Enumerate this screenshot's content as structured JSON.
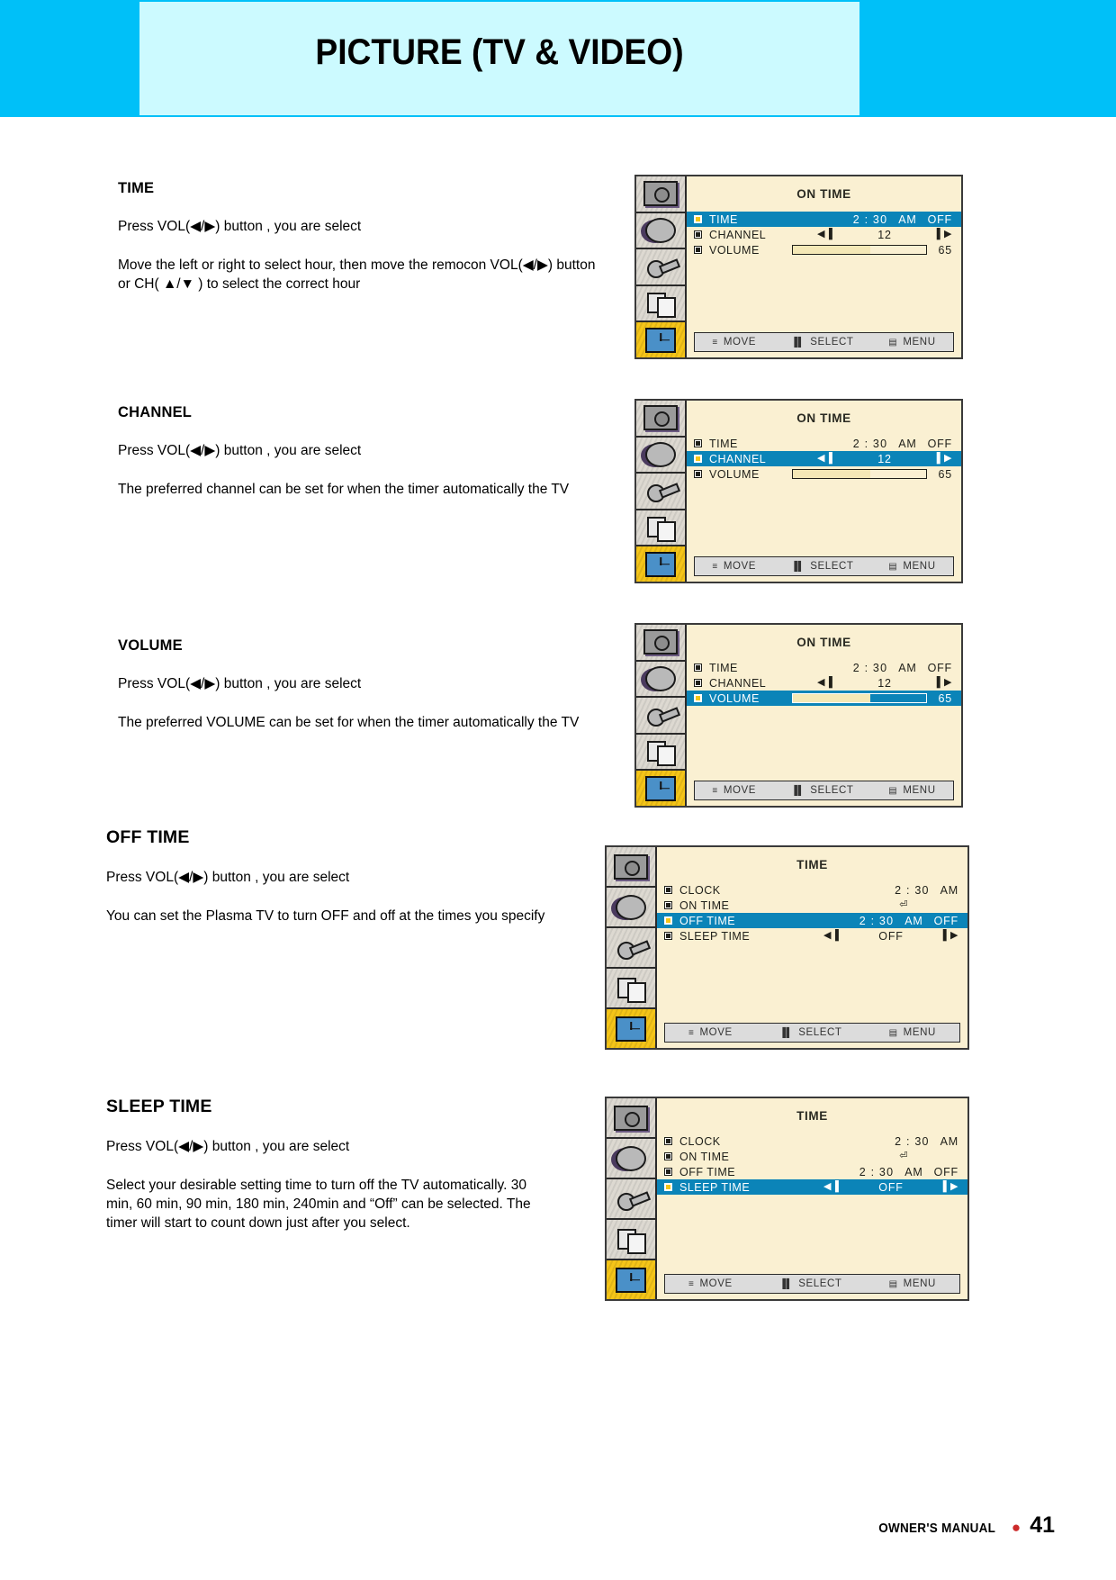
{
  "header": {
    "title": "PICTURE (TV & VIDEO)",
    "band_color": "#00c0f8",
    "panel_color": "#ccfaff"
  },
  "sections": [
    {
      "heading": "TIME",
      "heading_size": "small",
      "paragraphs": [
        "Press  VOL(◀/▶) button , you are select",
        "Move the left or right to select hour, then move the remocon VOL(◀/▶) button or CH( ▲/▼ ) to select the correct hour"
      ]
    },
    {
      "heading": "CHANNEL",
      "heading_size": "small",
      "paragraphs": [
        "Press  VOL(◀/▶) button , you are select",
        "The preferred channel can be set for when the timer automatically the TV"
      ]
    },
    {
      "heading": "VOLUME",
      "heading_size": "small",
      "paragraphs": [
        "Press  VOL(◀/▶) button , you are select",
        "The preferred VOLUME can be set for when the timer automatically the TV"
      ]
    },
    {
      "heading": "OFF TIME",
      "heading_size": "big",
      "paragraphs": [
        "Press  VOL(◀/▶) button , you are select",
        "You can set the Plasma TV to turn OFF and off at the times you specify"
      ]
    },
    {
      "heading": "SLEEP TIME",
      "heading_size": "big",
      "paragraphs": [
        "Press  VOL(◀/▶) button , you are select",
        "Select your desirable setting time to turn off the TV automatically. 30 min, 60 min, 90 min, 180 min, 240min and “Off” can be selected. The timer will start to count down just after you select."
      ]
    }
  ],
  "osd_common": {
    "footer": [
      {
        "icon": "move-icon",
        "label": "MOVE"
      },
      {
        "icon": "select-icon",
        "label": "SELECT"
      },
      {
        "icon": "menu-icon",
        "label": "MENU"
      }
    ],
    "side_icons": [
      "tv-picture-icon",
      "speaker-icon",
      "key-lock-icon",
      "window-pip-icon",
      "clock-timer-icon"
    ],
    "bg_color": "#faf0d2",
    "highlight_color": "#0b84b8",
    "selected_icon_color": "#f5c518"
  },
  "osd_screens": [
    {
      "name": "on-time-time",
      "title": "ON TIME",
      "rows": [
        {
          "label": "TIME",
          "highlight": true,
          "value_type": "time",
          "time": "2 : 30",
          "ampm": "AM",
          "off": "OFF"
        },
        {
          "label": "CHANNEL",
          "highlight": false,
          "value_type": "adjust",
          "number": "12"
        },
        {
          "label": "VOLUME",
          "highlight": false,
          "value_type": "gauge",
          "number": "65",
          "fill_percent": 58
        }
      ]
    },
    {
      "name": "on-time-channel",
      "title": "ON TIME",
      "rows": [
        {
          "label": "TIME",
          "highlight": false,
          "value_type": "time",
          "time": "2 : 30",
          "ampm": "AM",
          "off": "OFF"
        },
        {
          "label": "CHANNEL",
          "highlight": true,
          "value_type": "adjust",
          "number": "12"
        },
        {
          "label": "VOLUME",
          "highlight": false,
          "value_type": "gauge",
          "number": "65",
          "fill_percent": 58
        }
      ]
    },
    {
      "name": "on-time-volume",
      "title": "ON TIME",
      "rows": [
        {
          "label": "TIME",
          "highlight": false,
          "value_type": "time",
          "time": "2 : 30",
          "ampm": "AM",
          "off": "OFF"
        },
        {
          "label": "CHANNEL",
          "highlight": false,
          "value_type": "adjust",
          "number": "12"
        },
        {
          "label": "VOLUME",
          "highlight": true,
          "value_type": "gauge",
          "number": "65",
          "fill_percent": 58
        }
      ]
    },
    {
      "name": "time-off-time",
      "title": "TIME",
      "rows": [
        {
          "label": "CLOCK",
          "highlight": false,
          "value_type": "time",
          "time": "2 : 30",
          "ampm": "AM",
          "off": ""
        },
        {
          "label": "ON TIME",
          "highlight": false,
          "value_type": "icon_only"
        },
        {
          "label": "OFF TIME",
          "highlight": true,
          "value_type": "time",
          "time": "2 : 30",
          "ampm": "AM",
          "off": "OFF"
        },
        {
          "label": "SLEEP TIME",
          "highlight": false,
          "value_type": "adjust",
          "number": "OFF"
        }
      ]
    },
    {
      "name": "time-sleep-time",
      "title": "TIME",
      "rows": [
        {
          "label": "CLOCK",
          "highlight": false,
          "value_type": "time",
          "time": "2 : 30",
          "ampm": "AM",
          "off": ""
        },
        {
          "label": "ON TIME",
          "highlight": false,
          "value_type": "icon_only"
        },
        {
          "label": "OFF TIME",
          "highlight": false,
          "value_type": "time",
          "time": "2 : 30",
          "ampm": "AM",
          "off": "OFF"
        },
        {
          "label": "SLEEP TIME",
          "highlight": true,
          "value_type": "adjust",
          "number": "OFF"
        }
      ]
    }
  ],
  "page_footer": {
    "manual_text": "OWNER'S MANUAL",
    "dot": "●",
    "page_number": "41",
    "dot_color": "#cc2a2a"
  }
}
